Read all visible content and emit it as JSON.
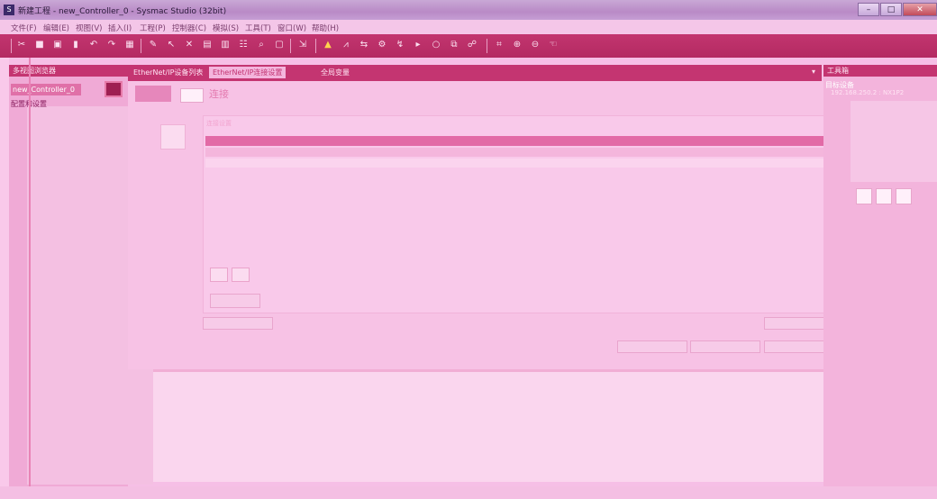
{
  "window": {
    "title": "新建工程 - new_Controller_0 - Sysmac Studio (32bit)",
    "app_icon": "S",
    "minimize": "–",
    "maximize": "□",
    "close": "✕"
  },
  "menu": [
    "文件(F)",
    "编辑(E)",
    "视图(V)",
    "插入(I)",
    "工程(P)",
    "控制器(C)",
    "模拟(S)",
    "工具(T)",
    "窗口(W)",
    "帮助(H)"
  ],
  "toolbar_icons": [
    "cut-icon",
    "copy-icon",
    "paste-icon",
    "delete-icon",
    "undo-icon",
    "redo-icon",
    "build-icon",
    "edit-icon",
    "arrow-icon",
    "cross-icon",
    "grid-icon",
    "print-icon",
    "people-icon",
    "find-icon",
    "window-icon",
    "jump-icon",
    "warning-icon",
    "chart-icon",
    "compare-icon",
    "settings-icon",
    "step-icon",
    "play-icon",
    "stop-icon",
    "copy2-icon",
    "zoom-fit-icon",
    "zoom-in-icon",
    "zoom-out-icon",
    "pointer-icon"
  ],
  "left": {
    "header": "多视图浏览器",
    "controller": "new_Controller_0",
    "tree_root": "配置和设置"
  },
  "center": {
    "tabs": [
      "EtherNet/IP设备列表",
      "EtherNet/IP连接设置",
      "全局变量"
    ],
    "active_title": "连接",
    "section_title": "连接设置"
  },
  "right": {
    "header": "工具箱",
    "subheader": "目标设备",
    "device": "192.168.250.2 : NX1P2"
  },
  "colors": {
    "accent": "#c43571",
    "background": "#f6bfe6"
  }
}
